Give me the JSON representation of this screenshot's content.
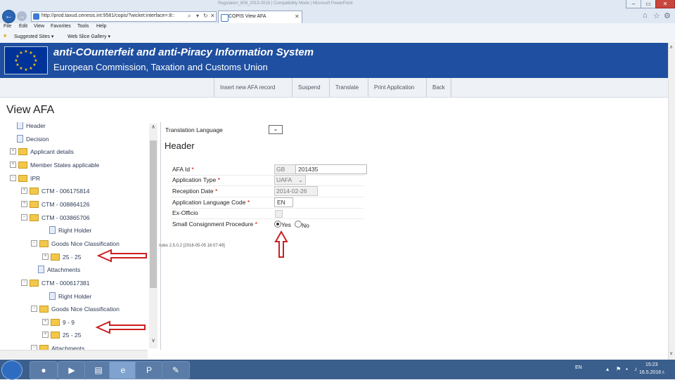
{
  "browser": {
    "window_title": "Regulation_608_2013-2016 | Compatibility Mode | Microsoft PowerPoint",
    "address": "http://prod.taxud.cenesis.int:9581/copis/?wicket:interface=:8::",
    "tab_title": "COPIS View AFA",
    "menu": [
      "File",
      "Edit",
      "View",
      "Favorites",
      "Tools",
      "Help"
    ],
    "favorites": [
      "Suggested Sites ▾",
      "Web Slice Gallery ▾"
    ]
  },
  "banner": {
    "line1": "anti-COunterfeit and anti-Piracy Information System",
    "line2": "European Commission, Taxation and Customs Union"
  },
  "toolbar": {
    "buttons": [
      "Insert new AFA record",
      "Suspend",
      "Translate",
      "Print Application",
      "Back"
    ]
  },
  "page_title": "View AFA",
  "tree": {
    "nodes": [
      {
        "label": "Header",
        "kind": "doc"
      },
      {
        "label": "Decision",
        "kind": "doc"
      },
      {
        "label": "Applicant details",
        "kind": "folder"
      },
      {
        "label": "Member States applicable",
        "kind": "folder"
      },
      {
        "label": "IPR",
        "kind": "folder"
      },
      {
        "label": "CTM - 006175814",
        "kind": "folder"
      },
      {
        "label": "CTM - 008864126",
        "kind": "folder"
      },
      {
        "label": "CTM - 003865706",
        "kind": "folder"
      },
      {
        "label": "Right Holder",
        "kind": "doc"
      },
      {
        "label": "Goods Nice Classification",
        "kind": "folder"
      },
      {
        "label": "25 - 25",
        "kind": "folder"
      },
      {
        "label": "Attachments",
        "kind": "doc"
      },
      {
        "label": "CTM - 000617381",
        "kind": "folder"
      },
      {
        "label": "Right Holder",
        "kind": "doc"
      },
      {
        "label": "Goods Nice Classification",
        "kind": "folder"
      },
      {
        "label": "9 - 9",
        "kind": "folder"
      },
      {
        "label": "25 - 25",
        "kind": "folder"
      },
      {
        "label": "Attachments",
        "kind": "folder"
      }
    ]
  },
  "form": {
    "translation_label": "Translation Language",
    "section_title": "Header",
    "fields": [
      {
        "label": "AFA Id",
        "required": "*",
        "prefix": "GB",
        "value": "201435"
      },
      {
        "label": "Application Type",
        "required": "*",
        "value": "UAFA"
      },
      {
        "label": "Reception Date",
        "required": "*",
        "value": "2014-02-26"
      },
      {
        "label": "Application Language Code",
        "required": "*",
        "value": "EN"
      },
      {
        "label": "Ex-Officio",
        "required": "",
        "value": ""
      },
      {
        "label": "Small Consignment Procedure",
        "required": "*",
        "options": [
          "Yes",
          "No"
        ],
        "selected": "Yes"
      }
    ],
    "version": "rules 2.5.0.2 [2016-05-05 16:07:49]"
  },
  "taskbar": {
    "lang": "EN",
    "time": "15:23",
    "date": "16.5.2016 г."
  },
  "annotation_color": "#cc1f1f"
}
